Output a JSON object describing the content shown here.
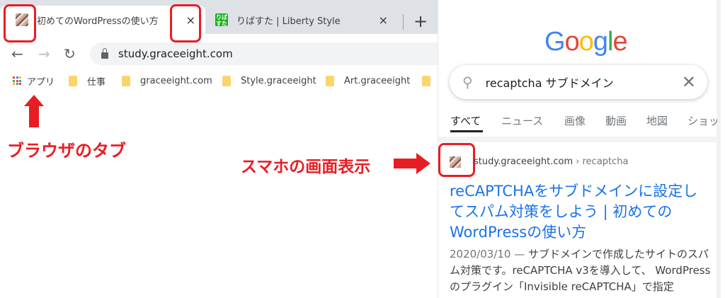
{
  "browser": {
    "tabs": [
      {
        "title": "初めてのWordPressの使い方",
        "active": true
      },
      {
        "title": "りばすた | Liberty Style",
        "active": false,
        "favicon_text": "りばすた"
      }
    ],
    "new_tab_label": "+",
    "close_label": "×",
    "address": "study.graceeight.com",
    "bookmarks": [
      {
        "label": "アプリ",
        "icon": "apps-grid-icon"
      },
      {
        "label": "仕事",
        "icon": "folder-icon"
      },
      {
        "label": "graceeight.com",
        "icon": "folder-icon"
      },
      {
        "label": "Style.graceeight",
        "icon": "folder-icon"
      },
      {
        "label": "Art.graceeight",
        "icon": "folder-icon"
      }
    ]
  },
  "annotations": {
    "browser_tab_label": "ブラウザのタブ",
    "mobile_view_label": "スマホの画面表示",
    "color": "#e81d23"
  },
  "mobile": {
    "logo": [
      "G",
      "o",
      "o",
      "g",
      "l",
      "e"
    ],
    "search_query": "recaptcha サブドメイン",
    "search_tabs": [
      "すべて",
      "ニュース",
      "画像",
      "動画",
      "地図",
      "ショッ"
    ],
    "result": {
      "domain": "study.graceeight.com",
      "path": "› recaptcha",
      "title": "reCAPTCHAをサブドメインに設定してスパム対策をしよう | 初めてのWordPressの使い方",
      "date": "2020/03/10 —",
      "snippet": "サブドメインで作成したサイトのスパム対策です。reCAPTCHA v3を導入して、 WordPressのプラグイン「Invisible reCAPTCHA」で指定"
    }
  }
}
